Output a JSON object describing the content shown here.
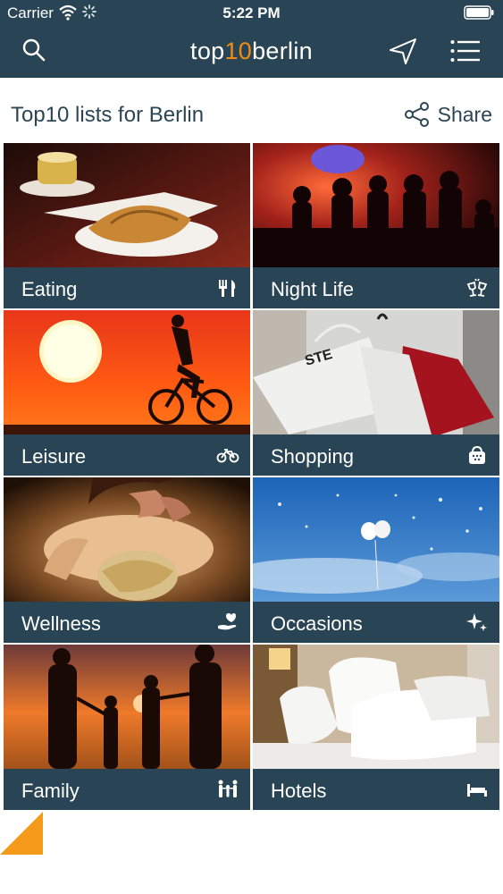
{
  "status_bar": {
    "carrier": "Carrier",
    "time": "5:22 PM"
  },
  "nav": {
    "logo_prefix": "top",
    "logo_number": "10",
    "logo_suffix": "berlin"
  },
  "page": {
    "title": "Top10 lists for Berlin",
    "share_label": "Share"
  },
  "categories": [
    {
      "label": "Eating",
      "icon": "fork-knife-icon"
    },
    {
      "label": "Night Life",
      "icon": "cheers-icon"
    },
    {
      "label": "Leisure",
      "icon": "bicycle-icon"
    },
    {
      "label": "Shopping",
      "icon": "shopping-bag-icon"
    },
    {
      "label": "Wellness",
      "icon": "hand-heart-icon"
    },
    {
      "label": "Occasions",
      "icon": "sparkles-icon"
    },
    {
      "label": "Family",
      "icon": "family-icon"
    },
    {
      "label": "Hotels",
      "icon": "bed-icon"
    }
  ],
  "colors": {
    "header": "#294555",
    "accent": "#f08c12",
    "text_dark": "#2c4555"
  }
}
